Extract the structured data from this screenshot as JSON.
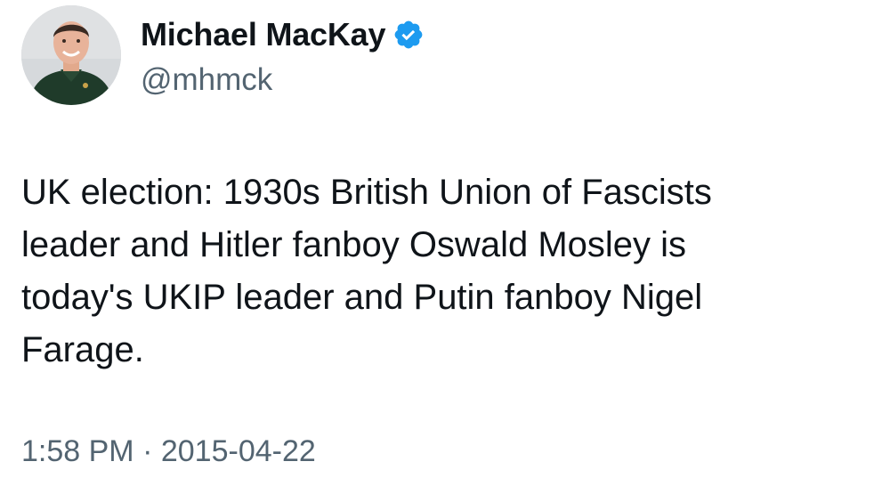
{
  "author": {
    "display_name": "Michael MacKay",
    "handle": "@mhmck",
    "verified": true,
    "verified_color": "#1d9bf0",
    "avatar_icon": "profile-photo"
  },
  "tweet": {
    "text": "UK election: 1930s British Union of Fascists\nleader and Hitler fanboy Oswald Mosley is\ntoday's UKIP leader and Putin fanboy Nigel\nFarage.",
    "time": "1:58 PM",
    "separator": "·",
    "date": "2015-04-22"
  },
  "colors": {
    "text": "#0f1419",
    "secondary": "#536471",
    "background": "#ffffff"
  }
}
